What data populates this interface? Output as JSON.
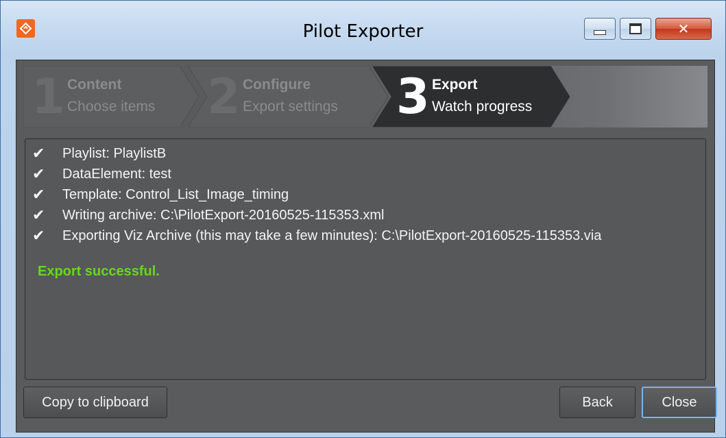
{
  "window": {
    "title": "Pilot Exporter",
    "icon": "pilot-logo-icon",
    "accent": "#f26722"
  },
  "steps": [
    {
      "number": "1",
      "title": "Content",
      "subtitle": "Choose items",
      "active": false
    },
    {
      "number": "2",
      "title": "Configure",
      "subtitle": "Export settings",
      "active": false
    },
    {
      "number": "3",
      "title": "Export",
      "subtitle": "Watch progress",
      "active": true
    }
  ],
  "log": {
    "lines": [
      "Playlist: PlaylistB",
      "DataElement: test",
      "Template: Control_List_Image_timing",
      "Writing archive: C:\\PilotExport-20160525-115353.xml",
      "Exporting Viz Archive (this may take a few minutes): C:\\PilotExport-20160525-115353.via"
    ],
    "status": "Export successful.",
    "status_color": "#66d91a"
  },
  "buttons": {
    "copy": "Copy to clipboard",
    "back": "Back",
    "close": "Close"
  }
}
